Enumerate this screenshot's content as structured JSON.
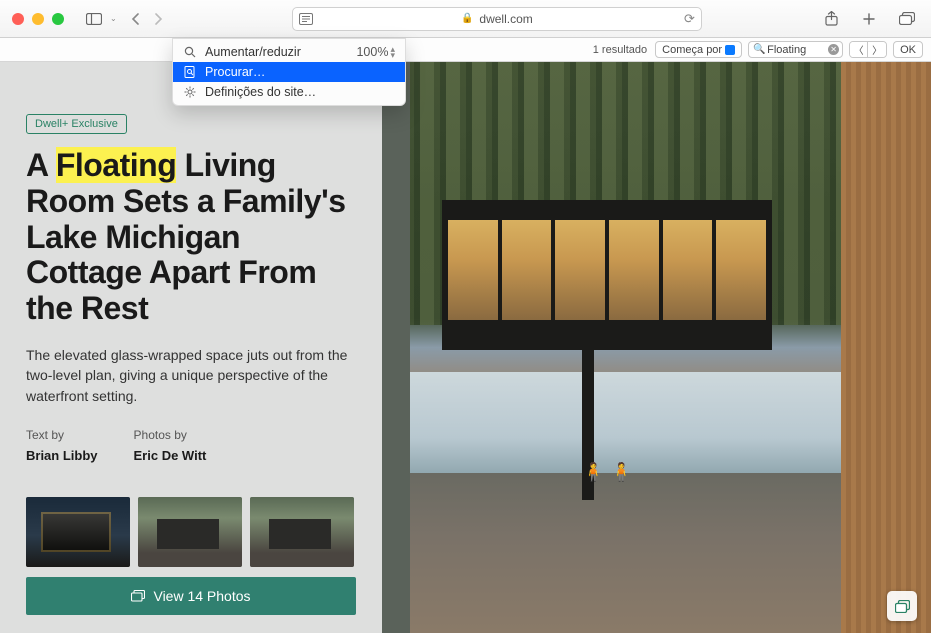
{
  "toolbar": {
    "domain": "dwell.com"
  },
  "menu": {
    "zoom_label": "Aumentar/reduzir",
    "zoom_value": "100%",
    "find_label": "Procurar…",
    "settings_label": "Definições do site…"
  },
  "findbar": {
    "result_count": "1 resultado",
    "mode_label": "Começa por",
    "query": "Floating",
    "ok_label": "OK"
  },
  "article": {
    "badge": "Dwell+ Exclusive",
    "headline_pre": "A ",
    "headline_highlight": "Floating",
    "headline_post": " Living Room Sets a Family's Lake Michigan Cottage Apart From the Rest",
    "subhead": "The elevated glass-wrapped space juts out from the two-level plan, giving a unique perspective of the waterfront setting.",
    "text_by_label": "Text by",
    "text_by_name": "Brian Libby",
    "photos_by_label": "Photos by",
    "photos_by_name": "Eric De Witt",
    "view_photos_label": "View 14 Photos"
  }
}
